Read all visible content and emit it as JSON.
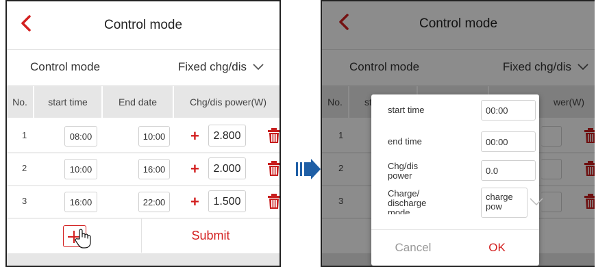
{
  "left": {
    "title": "Control mode",
    "control_mode_label": "Control mode",
    "control_mode_value": "Fixed chg/dis",
    "columns": [
      "No.",
      "start time",
      "End date",
      "Chg/dis power(W)"
    ],
    "rows": [
      {
        "no": "1",
        "start": "08:00",
        "end": "10:00",
        "sign": "+",
        "power": "2.800"
      },
      {
        "no": "2",
        "start": "10:00",
        "end": "16:00",
        "sign": "+",
        "power": "2.000"
      },
      {
        "no": "3",
        "start": "16:00",
        "end": "22:00",
        "sign": "+",
        "power": "1.500"
      }
    ],
    "submit": "Submit"
  },
  "right": {
    "title": "Control mode",
    "control_mode_label": "Control mode",
    "control_mode_value": "Fixed chg/dis",
    "col_no": "No.",
    "col_start_partial": "st",
    "col_power_partial": "wer(W)",
    "rows": [
      {
        "no": "1"
      },
      {
        "no": "2"
      },
      {
        "no": "3"
      }
    ],
    "dialog": {
      "start_label": "start time",
      "start_value": "00:00",
      "end_label": "end time",
      "end_value": "00:00",
      "power_label_1": "Chg/dis",
      "power_label_2": "power",
      "power_value": "0.0",
      "mode_label_1": "Charge/",
      "mode_label_2": "discharge",
      "mode_label_3": "mode",
      "mode_value_1": "charge",
      "mode_value_2": "pow",
      "cancel": "Cancel",
      "ok": "OK"
    }
  },
  "colors": {
    "accent": "#d32020",
    "header_bg": "#e6e6e6",
    "arrow": "#1f5fa6"
  }
}
